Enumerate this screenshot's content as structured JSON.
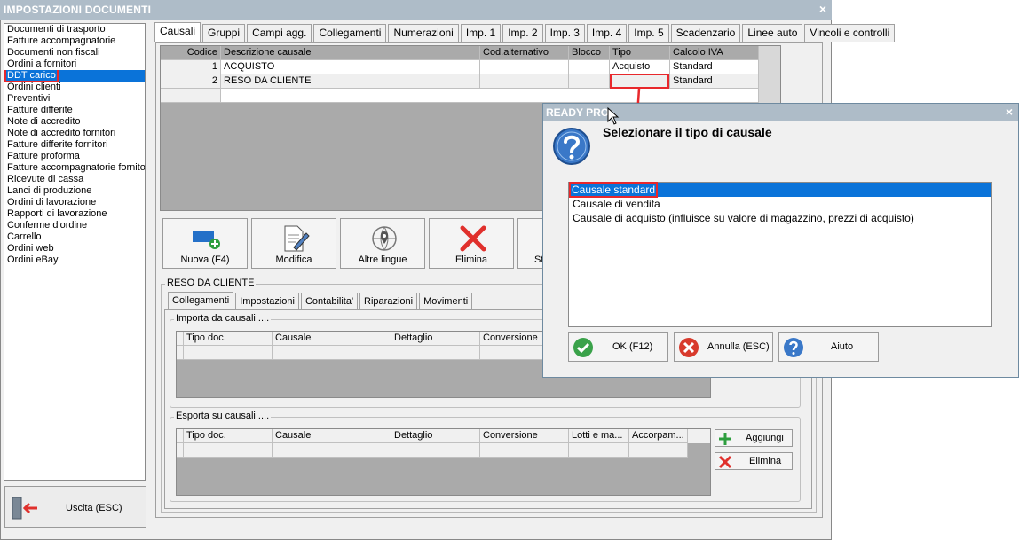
{
  "window": {
    "title": "IMPOSTAZIONI DOCUMENTI",
    "close_glyph": "×"
  },
  "sidebar": {
    "items": [
      "Documenti di trasporto",
      "Fatture accompagnatorie",
      "Documenti non fiscali",
      "Ordini a fornitori",
      "DDT carico",
      "Ordini clienti",
      "Preventivi",
      "Fatture differite",
      "Note di accredito",
      "Note di accredito fornitori",
      "Fatture differite fornitori",
      "Fatture proforma",
      "Fatture accompagnatorie fornito",
      "Ricevute di cassa",
      "Lanci di produzione",
      "Ordini di lavorazione",
      "Rapporti di lavorazione",
      "Conferme d'ordine",
      "Carrello",
      "Ordini web",
      "Ordini eBay"
    ],
    "selected_index": 4,
    "exit_label": "Uscita (ESC)"
  },
  "tabs": [
    "Causali",
    "Gruppi",
    "Campi agg.",
    "Collegamenti",
    "Numerazioni",
    "Imp. 1",
    "Imp. 2",
    "Imp. 3",
    "Imp. 4",
    "Imp. 5",
    "Scadenzario",
    "Linee auto",
    "Vincoli e controlli"
  ],
  "active_tab": 0,
  "grid": {
    "columns": [
      "Codice",
      "Descrizione causale",
      "Cod.alternativo",
      "Blocco",
      "Tipo",
      "Calcolo IVA"
    ],
    "rows": [
      {
        "codice": "1",
        "descrizione": "ACQUISTO",
        "cod_alt": "",
        "blocco": "",
        "tipo": "Acquisto",
        "calcolo_iva": "Standard"
      },
      {
        "codice": "2",
        "descrizione": "RESO DA CLIENTE",
        "cod_alt": "",
        "blocco": "",
        "tipo": "",
        "calcolo_iva": "Standard"
      }
    ]
  },
  "actions": {
    "new": "Nuova (F4)",
    "edit": "Modifica",
    "languages": "Altre lingue",
    "delete": "Elimina",
    "partial": "St"
  },
  "detail": {
    "title": "RESO DA CLIENTE",
    "subtabs": [
      "Collegamenti",
      "Impostazioni",
      "Contabilita'",
      "Riparazioni",
      "Movimenti"
    ],
    "import_group": {
      "title": "Importa da causali ....",
      "columns": [
        "Tipo doc.",
        "Causale",
        "Dettaglio",
        "Conversione"
      ]
    },
    "export_group": {
      "title": "Esporta su causali ....",
      "columns": [
        "Tipo doc.",
        "Causale",
        "Dettaglio",
        "Conversione",
        "Lotti e ma...",
        "Accorpam..."
      ],
      "add_label": "Aggiungi",
      "delete_label": "Elimina"
    }
  },
  "dialog": {
    "title": "READY PRO",
    "question": "Selezionare il tipo di causale",
    "options": [
      "Causale standard",
      "Causale di vendita",
      "Causale di acquisto (influisce su valore di magazzino, prezzi di acquisto)"
    ],
    "selected_index": 0,
    "ok_label": "OK (F12)",
    "cancel_label": "Annulla (ESC)",
    "help_label": "Aiuto",
    "close_glyph": "×"
  },
  "colors": {
    "selection": "#0a73d9",
    "highlight": "#e8282c",
    "titlebar": "#aebcc8"
  }
}
